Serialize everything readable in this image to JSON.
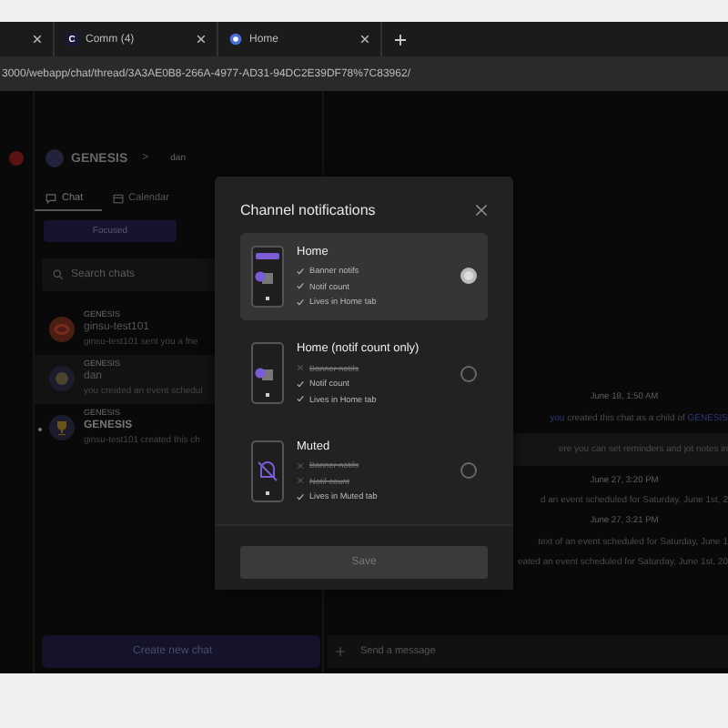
{
  "browser": {
    "tabs": [
      {
        "close": true
      },
      {
        "label": "Comm (4)",
        "favicon": "C"
      },
      {
        "label": "Home"
      }
    ],
    "url": "3000/webapp/chat/thread/3A3AE0B8-266A-4977-AD31-94DC2E39DF78%7C83962/"
  },
  "sidebar": {
    "workspace": "GENESIS",
    "separator": ">",
    "channel": "dan",
    "tabs": [
      {
        "label": "Chat",
        "kind": "chat",
        "selected": true
      },
      {
        "label": "Calendar",
        "kind": "calendar",
        "selected": false
      }
    ],
    "filter": "Focused",
    "search": {
      "placeholder": "Search chats"
    },
    "chats": [
      {
        "group": "GENESIS",
        "name": "ginsu-test101",
        "preview": "ginsu-test101 sent you a frie",
        "kind": "ring",
        "selected": false,
        "unread": false
      },
      {
        "group": "GENESIS",
        "name": "dan",
        "preview": "you created an event schedul",
        "kind": "globe",
        "selected": true,
        "unread": false
      },
      {
        "group": "GENESIS",
        "name": "GENESIS",
        "preview": "ginsu-test101 created this ch",
        "kind": "trophy",
        "selected": false,
        "unread": true
      }
    ],
    "create_button": "Create new chat"
  },
  "chat": {
    "messages": [
      {
        "kind": "time",
        "text": "June 18, 1:50 AM"
      },
      {
        "kind": "event",
        "actor": "you",
        "text": "created this chat as a child of",
        "link": "GENESIS"
      },
      {
        "kind": "note",
        "text": "ere you can set reminders and jot notes in"
      },
      {
        "kind": "time",
        "text": "June 27, 3:20 PM"
      },
      {
        "kind": "line",
        "text": "d an event scheduled for Saturday, June 1st, 2"
      },
      {
        "kind": "time",
        "text": "June 27, 3:21 PM"
      },
      {
        "kind": "line",
        "text": "text of an event scheduled for Saturday, June 1"
      },
      {
        "kind": "line",
        "text": "eated an event scheduled for Saturday, June 1st, 20"
      }
    ],
    "composer": {
      "placeholder": "Send a message"
    }
  },
  "dialog": {
    "title": "Channel notifications",
    "options": [
      {
        "title": "Home",
        "kind": "banner",
        "selected": true,
        "features": [
          {
            "label": "Banner notifs",
            "enabled": true
          },
          {
            "label": "Notif count",
            "enabled": true
          },
          {
            "label": "Lives in Home tab",
            "enabled": true
          }
        ]
      },
      {
        "title": "Home (notif count only)",
        "kind": "count",
        "selected": false,
        "features": [
          {
            "label": "Banner notifs",
            "enabled": false
          },
          {
            "label": "Notif count",
            "enabled": true
          },
          {
            "label": "Lives in Home tab",
            "enabled": true
          }
        ]
      },
      {
        "title": "Muted",
        "kind": "muted",
        "selected": false,
        "features": [
          {
            "label": "Banner notifs",
            "enabled": false
          },
          {
            "label": "Notif count",
            "enabled": false
          },
          {
            "label": "Lives in Muted tab",
            "enabled": true
          }
        ]
      }
    ],
    "save": {
      "label": "Save",
      "disabled": true
    }
  }
}
